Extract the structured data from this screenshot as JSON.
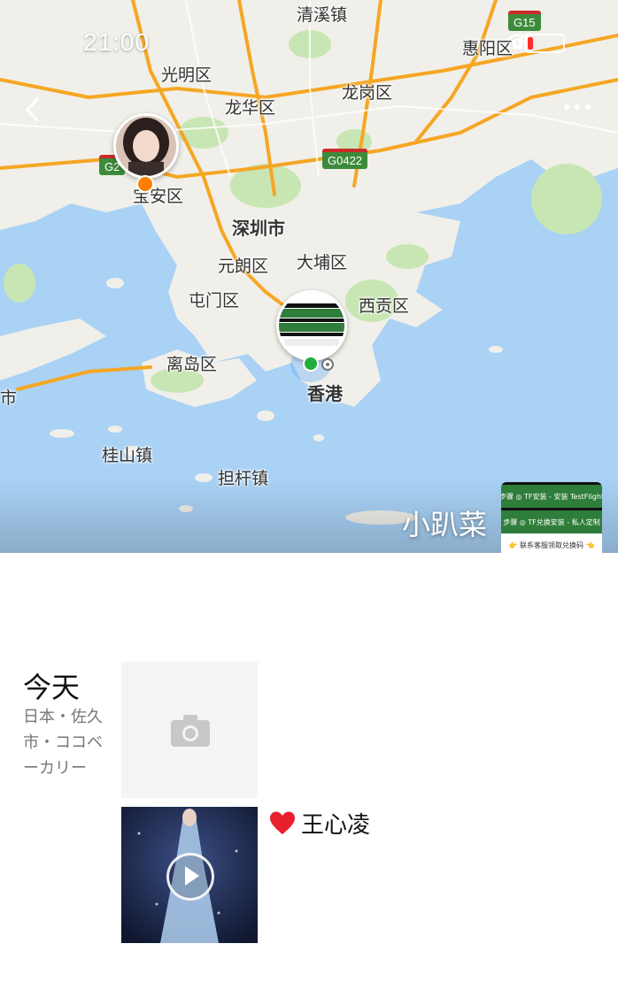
{
  "status_bar": {
    "time": "21:00"
  },
  "map": {
    "labels": {
      "qingxi": "清溪镇",
      "huiyang": "惠阳区",
      "guangming": "光明区",
      "longhua": "龙华区",
      "longgang": "龙岗区",
      "baoan": "宝安区",
      "shenzhen": "深圳市",
      "yuanlang": "元朗区",
      "dapu": "大埔区",
      "tunmen": "屯门区",
      "xigong": "西贡区",
      "lidao": "离岛区",
      "hongkong": "香港",
      "guishan": "桂山镇",
      "dangan": "担杆镇",
      "edge": "市"
    },
    "road_shields": {
      "g15": "G15",
      "g0422": "G0422",
      "g2": "G2"
    }
  },
  "profile": {
    "user_name": "小趴菜",
    "cover_lines": [
      "步骤 ◎ TF安装 - 安装 TestFlight",
      "步骤 ◎ TF兑换安装 - 私人定制",
      "👉 联系客服领取兑换码 👈"
    ]
  },
  "timeline": {
    "date": "今天",
    "location": "日本・佐久市・ココベーカリー",
    "post_text": "王心凌"
  },
  "colors": {
    "water": "#a9d2f5",
    "land": "#f1efe9",
    "park": "#c8e6b4",
    "road": "#f5a623",
    "pin_orange": "#ff7f00",
    "pin_green": "#1fae3a"
  },
  "icons": {
    "back": "chevron-left-icon",
    "more": "more-dots-icon",
    "camera": "camera-icon",
    "play": "play-icon",
    "heart": "heart-icon"
  }
}
